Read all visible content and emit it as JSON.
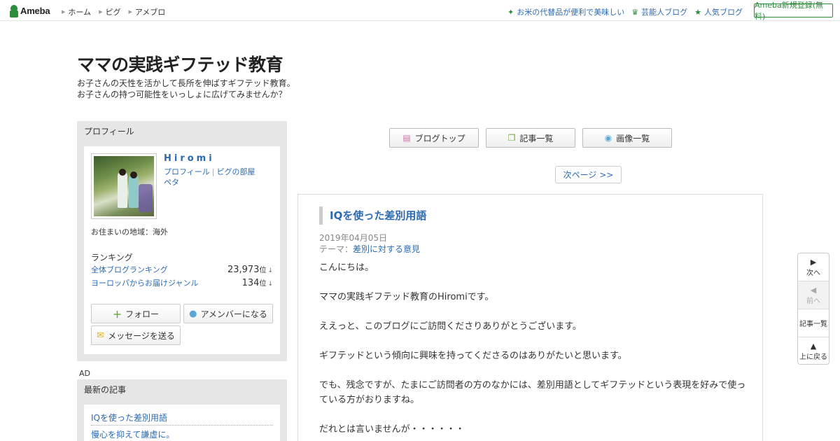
{
  "topbar": {
    "logo_text": "Ameba",
    "nav": [
      "ホーム",
      "ピグ",
      "アメブロ"
    ],
    "right_links": [
      {
        "icon": "sparkle-icon",
        "glyph": "✦",
        "label": "お米の代替品が便利で美味しい"
      },
      {
        "icon": "crown-icon",
        "glyph": "♛",
        "label": "芸能人ブログ"
      },
      {
        "icon": "star-icon",
        "glyph": "★",
        "label": "人気ブログ"
      }
    ],
    "register_label": "Ameba新規登録(無料)"
  },
  "header": {
    "title": "ママの実践ギフテッド教育",
    "description_lines": [
      "お子さんの天性を活かして長所を伸ばすギフテッド教育。",
      "お子さんの持つ可能性をいっしょに広げてみませんか？"
    ]
  },
  "sidebar": {
    "profile_heading": "プロフィール",
    "name": "Hiromi",
    "links": {
      "profile": "プロフィール",
      "pig_room": "ピグの部屋",
      "peta": "ペタ"
    },
    "region": "お住まいの地域：海外",
    "ranking_title": "ランキング",
    "rankings": [
      {
        "label": "全体ブログランキング",
        "value": "23,973",
        "unit": "位",
        "arrow": "↓"
      },
      {
        "label": "ヨーロッパからお届けジャンル",
        "value": "134",
        "unit": "位",
        "arrow": "↓"
      }
    ],
    "buttons": {
      "follow": "フォロー",
      "amember": "アメンバーになる",
      "message": "メッセージを送る"
    },
    "ad_label": "AD",
    "recent_heading": "最新の記事",
    "recent_items": [
      "IQを使った差別用語",
      "慢心を抑えて謙虚に。"
    ]
  },
  "main": {
    "tools": {
      "blog_top": "ブログトップ",
      "entries": "記事一覧",
      "images": "画像一覧"
    },
    "next_page": "次ページ >>",
    "article": {
      "title": "IQを使った差別用語",
      "date": "2019年04月05日",
      "theme_label": "テーマ：",
      "theme": "差別に対する意見",
      "paragraphs": [
        "こんにちは。",
        "ママの実践ギフテッド教育のHiromiです。",
        "ええっと、このブログにご訪問くださりありがとうございます。",
        "ギフテッドという傾向に興味を持ってくださるのはありがたいと思います。",
        "でも、残念ですが、たまにご訪問者の方のなかには、差別用語としてギフテッドという表現を好みで使っている方がおりますね。",
        "だれとは言いませんが・・・・・・"
      ]
    }
  },
  "side_nav": {
    "next": "次へ",
    "prev": "前へ",
    "list": "記事一覧",
    "top": "上に戻る"
  },
  "colors": {
    "link": "#2b6ab2",
    "ameba_green": "#2d8c3c",
    "panel_gray": "#e6e6e6"
  }
}
